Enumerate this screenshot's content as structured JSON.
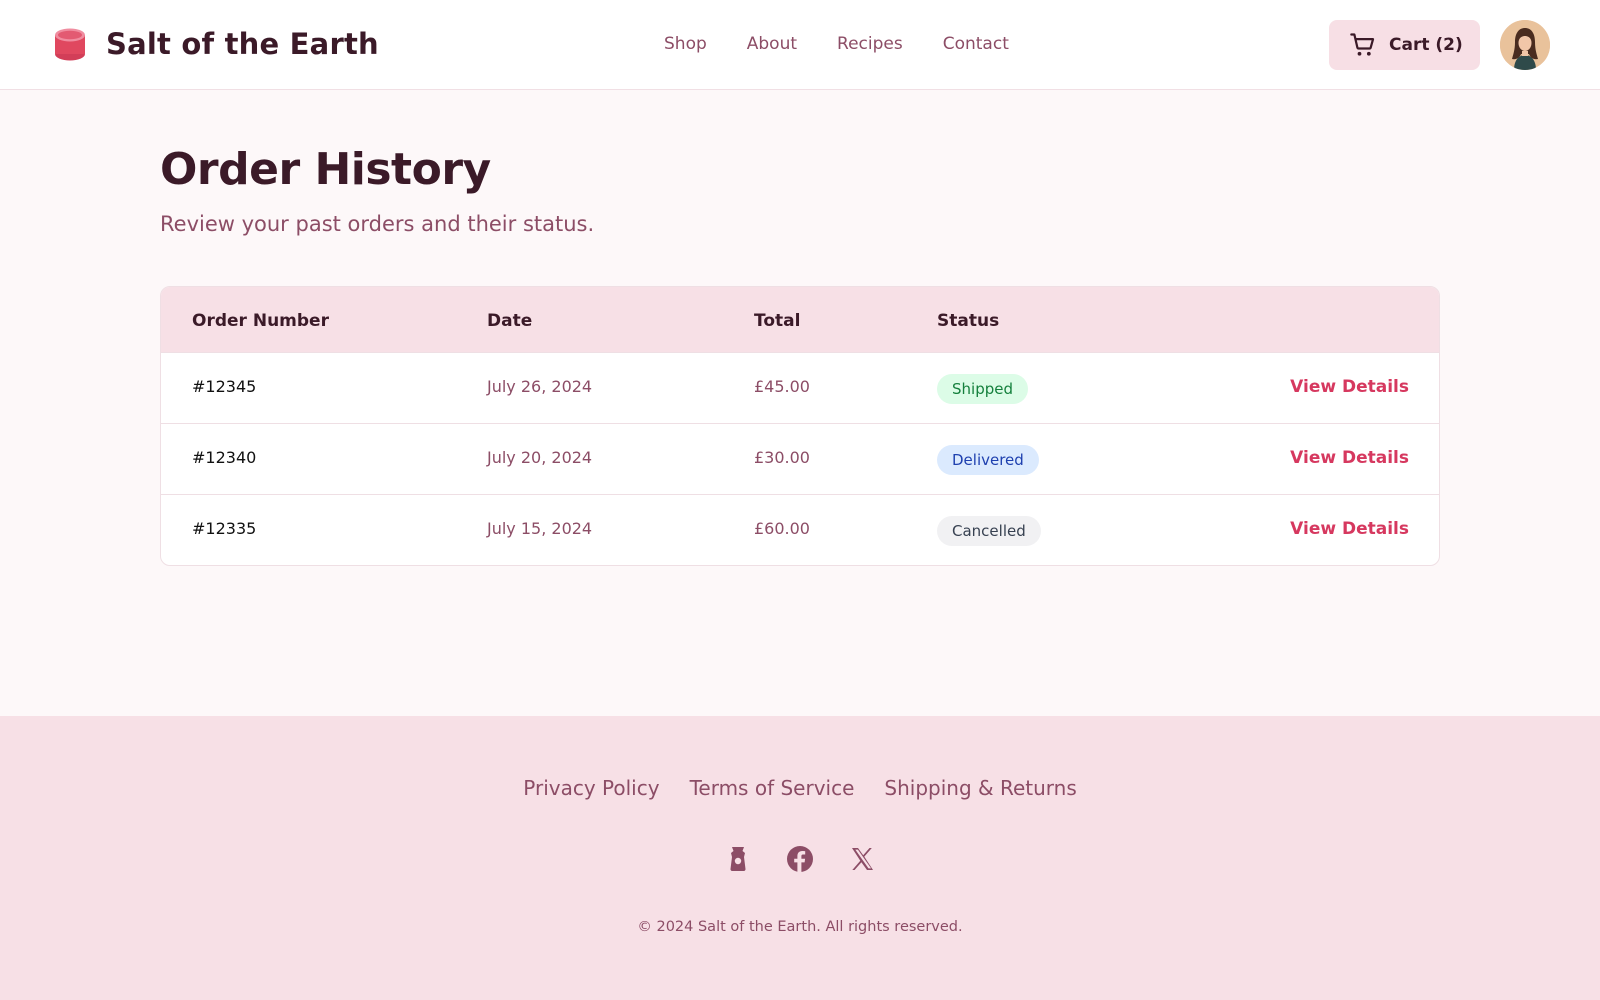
{
  "brand": {
    "name": "Salt of the Earth",
    "icon": "salt-cellar-icon",
    "accent": "#e0485f"
  },
  "nav": {
    "items": [
      {
        "label": "Shop"
      },
      {
        "label": "About"
      },
      {
        "label": "Recipes"
      },
      {
        "label": "Contact"
      }
    ]
  },
  "cart": {
    "label": "Cart (2)",
    "icon": "shopping-cart-icon"
  },
  "user": {
    "avatar": "user-avatar"
  },
  "main": {
    "title": "Order History",
    "subtitle": "Review your past orders and their status."
  },
  "table": {
    "headers": {
      "order": "Order Number",
      "date": "Date",
      "total": "Total",
      "status": "Status"
    },
    "rows": [
      {
        "order": "#12345",
        "date": "July 26, 2024",
        "total": "£45.00",
        "status": "Shipped",
        "action": "View Details"
      },
      {
        "order": "#12340",
        "date": "July 20, 2024",
        "total": "£30.00",
        "status": "Delivered",
        "action": "View Details"
      },
      {
        "order": "#12335",
        "date": "July 15, 2024",
        "total": "£60.00",
        "status": "Cancelled",
        "action": "View Details"
      }
    ]
  },
  "footer": {
    "links": [
      {
        "label": "Privacy Policy"
      },
      {
        "label": "Terms of Service"
      },
      {
        "label": "Shipping & Returns"
      }
    ],
    "socials": [
      "instagram-icon",
      "facebook-icon",
      "x-icon"
    ],
    "copyright": "© 2024 Salt of the Earth. All rights reserved."
  },
  "colors": {
    "primary_text": "#3b1a28",
    "muted_text": "#8c4d66",
    "link": "#d6385f",
    "header_row_bg": "#f7e0e6",
    "page_bg": "#fdf8f9"
  }
}
